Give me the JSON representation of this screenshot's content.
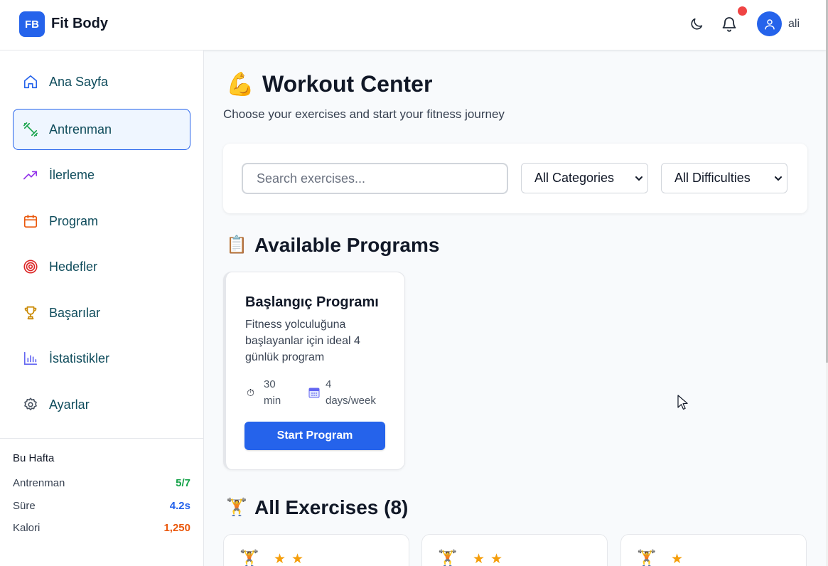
{
  "header": {
    "logo_initials": "FB",
    "brand_name": "Fit Body",
    "username": "ali",
    "theme_icon": "moon-icon",
    "notification_icon": "bell-icon",
    "user_icon": "user-icon",
    "accent_color": "#2563eb",
    "notification_dot_color": "#ef4444"
  },
  "sidebar": {
    "items": [
      {
        "label": "Ana Sayfa",
        "icon": "home-icon",
        "active": false
      },
      {
        "label": "Antrenman",
        "icon": "dumbbell-icon",
        "active": true
      },
      {
        "label": "İlerleme",
        "icon": "trending-up-icon",
        "active": false
      },
      {
        "label": "Program",
        "icon": "calendar-icon",
        "active": false
      },
      {
        "label": "Hedefler",
        "icon": "target-icon",
        "active": false
      },
      {
        "label": "Başarılar",
        "icon": "trophy-icon",
        "active": false
      },
      {
        "label": "İstatistikler",
        "icon": "bar-chart-icon",
        "active": false
      },
      {
        "label": "Ayarlar",
        "icon": "settings-icon",
        "active": false
      }
    ],
    "weekly": {
      "title": "Bu Hafta",
      "stats": [
        {
          "label": "Antrenman",
          "value": "5/7",
          "color": "#16a34a"
        },
        {
          "label": "Süre",
          "value": "4.2s",
          "color": "#2563eb"
        },
        {
          "label": "Kalori",
          "value": "1,250",
          "color": "#ea580c"
        }
      ]
    }
  },
  "main": {
    "title_emoji": "💪",
    "title": "Workout Center",
    "subtitle": "Choose your exercises and start your fitness journey",
    "filters": {
      "search_placeholder": "Search exercises...",
      "category_selected": "All Categories",
      "difficulty_selected": "All Difficulties"
    },
    "programs_section": {
      "emoji": "📋",
      "title": "Available Programs",
      "programs": [
        {
          "name": "Başlangıç Programı",
          "description": "Fitness yolculuğuna başlayanlar için ideal 4 günlük program",
          "duration_value": "30",
          "duration_unit": "min",
          "frequency_value": "4",
          "frequency_unit": "days/week",
          "duration_icon": "stopwatch-icon",
          "frequency_icon": "calendar-icon",
          "button_label": "Start Program"
        }
      ]
    },
    "exercises_section": {
      "emoji": "🏋️",
      "title": "All Exercises (8)",
      "cards": [
        {
          "emoji": "🏋️",
          "stars": "★★",
          "difficulty_stars": 2
        },
        {
          "emoji": "🏋️",
          "stars": "★★",
          "difficulty_stars": 2
        },
        {
          "emoji": "🏋️",
          "stars": "★",
          "difficulty_stars": 1
        }
      ]
    }
  }
}
